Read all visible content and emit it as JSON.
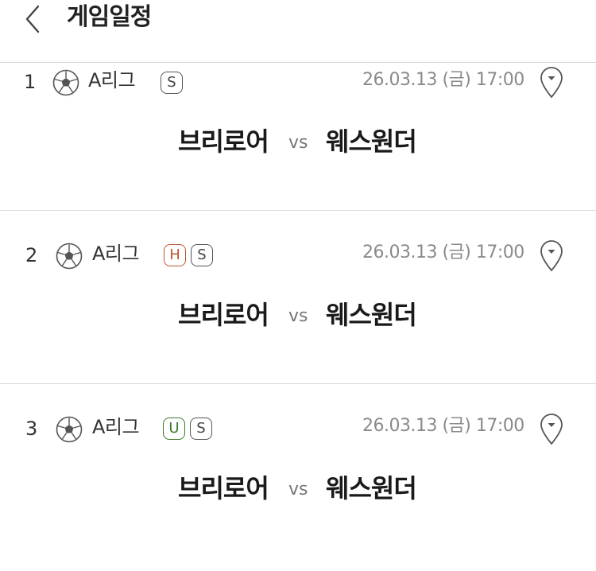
{
  "header": {
    "title": "게임일정",
    "back_icon": "chevron-left-icon"
  },
  "games": [
    {
      "no": "1",
      "league": "A리그",
      "badges": [
        "S"
      ],
      "date": "26.03.13 (금) 17:00",
      "home": "브리로어",
      "vs": "vs",
      "away": "웨스원더"
    },
    {
      "no": "2",
      "league": "A리그",
      "badges": [
        "H",
        "S"
      ],
      "date": "26.03.13 (금) 17:00",
      "home": "브리로어",
      "vs": "vs",
      "away": "웨스원더"
    },
    {
      "no": "3",
      "league": "A리그",
      "badges": [
        "U",
        "S"
      ],
      "date": "26.03.13 (금) 17:00",
      "home": "브리로어",
      "vs": "vs",
      "away": "웨스원더"
    }
  ],
  "colors": {
    "badge_h": "#c0542a",
    "badge_u": "#3a7a2a",
    "divider": "#d9d9d9",
    "date_text": "#8a8a8a"
  }
}
